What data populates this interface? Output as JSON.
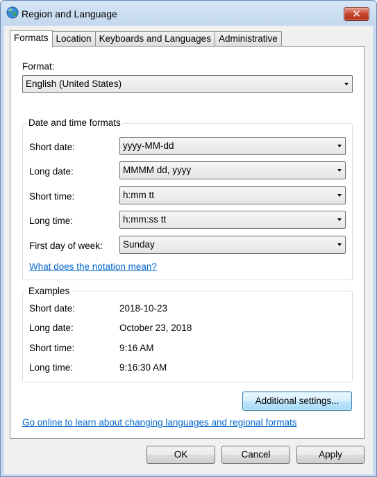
{
  "window": {
    "title": "Region and Language",
    "close_label": "✕"
  },
  "tabs": [
    "Formats",
    "Location",
    "Keyboards and Languages",
    "Administrative"
  ],
  "format": {
    "label": "Format:",
    "value": "English (United States)"
  },
  "date_time_formats": {
    "title": "Date and time formats",
    "rows": [
      {
        "label": "Short date:",
        "value": "yyyy-MM-dd"
      },
      {
        "label": "Long date:",
        "value": "MMMM dd, yyyy"
      },
      {
        "label": "Short time:",
        "value": "h:mm tt"
      },
      {
        "label": "Long time:",
        "value": "h:mm:ss tt"
      },
      {
        "label": "First day of week:",
        "value": "Sunday"
      }
    ],
    "notation_link": "What does the notation mean?"
  },
  "examples": {
    "title": "Examples",
    "rows": [
      {
        "label": "Short date:",
        "value": "2018-10-23"
      },
      {
        "label": "Long date:",
        "value": "October 23, 2018"
      },
      {
        "label": "Short time:",
        "value": "9:16 AM"
      },
      {
        "label": "Long time:",
        "value": "9:16:30 AM"
      }
    ]
  },
  "additional_settings_label": "Additional settings...",
  "online_link": "Go online to learn about changing languages and regional formats",
  "buttons": {
    "ok": "OK",
    "cancel": "Cancel",
    "apply": "Apply"
  }
}
